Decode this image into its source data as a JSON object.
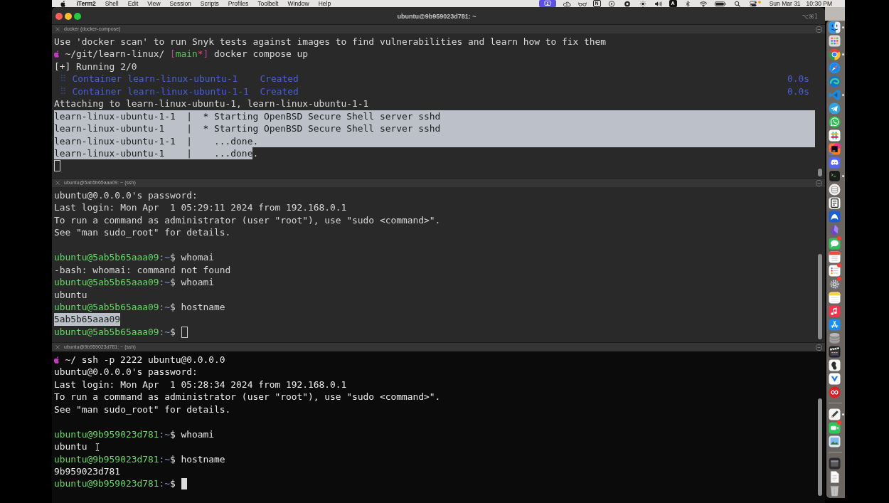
{
  "menu_bar": {
    "menus": [
      {
        "label": "iTerm2",
        "kind": "app"
      },
      {
        "label": "Shell",
        "kind": "menu"
      },
      {
        "label": "Edit",
        "kind": "menu"
      },
      {
        "label": "View",
        "kind": "menu"
      },
      {
        "label": "Session",
        "kind": "menu"
      },
      {
        "label": "Scripts",
        "kind": "menu"
      },
      {
        "label": "Profiles",
        "kind": "menu"
      },
      {
        "label": "Toolbelt",
        "kind": "menu"
      },
      {
        "label": "Window",
        "kind": "menu"
      },
      {
        "label": "Help",
        "kind": "menu"
      }
    ],
    "status_items": [
      {
        "kind": "screen-share",
        "active": true
      },
      {
        "kind": "cloud",
        "active": false
      },
      {
        "kind": "glasses",
        "active": false
      },
      {
        "kind": "boxed-letter",
        "text": "N",
        "active": false
      },
      {
        "kind": "play-circle",
        "active": false
      },
      {
        "kind": "disc",
        "active": false
      },
      {
        "kind": "sun",
        "active": false
      },
      {
        "kind": "speaker",
        "active": false
      },
      {
        "kind": "letter-tile",
        "text": "A",
        "active": false
      },
      {
        "kind": "bluetooth",
        "active": false
      },
      {
        "kind": "wifi",
        "active": false
      },
      {
        "kind": "battery",
        "active": false
      },
      {
        "kind": "search",
        "active": false
      },
      {
        "kind": "control-center",
        "active": false
      },
      {
        "kind": "indicator-dot",
        "active": false
      }
    ],
    "date": "Sun Mar 31",
    "time": "10:30 PM"
  },
  "window": {
    "title": "ubuntu@9b959023d781: ~",
    "shortcut": "⌥⌘1"
  },
  "panes": [
    {
      "title": "docker (docker-compose)",
      "active": false,
      "blocks": [
        {
          "lines": [
            {
              "segments": [
                {
                  "kind": "text",
                  "text": "Use 'docker scan' to run Snyk tests against images to find vulnerabilities and learn how to fix them",
                  "selected": false
                }
              ]
            },
            {
              "segments": [
                {
                  "kind": "logo",
                  "selected": false
                },
                {
                  "kind": "text",
                  "text": " ~/git/learn-linux/ ",
                  "selected": false
                },
                {
                  "kind": "bracket",
                  "text": "[",
                  "selected": false
                },
                {
                  "kind": "branch",
                  "text": "main",
                  "selected": false
                },
                {
                  "kind": "dirty",
                  "text": "*",
                  "selected": false
                },
                {
                  "kind": "bracket",
                  "text": "]",
                  "selected": false
                },
                {
                  "kind": "text",
                  "text": " docker compose up",
                  "selected": false
                }
              ]
            },
            {
              "segments": [
                {
                  "kind": "text",
                  "text": "[+] Running 2/0",
                  "selected": false
                }
              ]
            },
            {
              "segments": [
                {
                  "kind": "dots",
                  "text": " ⠿ ",
                  "selected": false
                },
                {
                  "kind": "info",
                  "text": "Container learn-linux-ubuntu-1    Created",
                  "selected": false
                },
                {
                  "kind": "timing",
                  "text": "0.0s",
                  "selected": false
                }
              ]
            },
            {
              "segments": [
                {
                  "kind": "dots",
                  "text": " ⠿ ",
                  "selected": false
                },
                {
                  "kind": "info",
                  "text": "Container learn-linux-ubuntu-1-1  Created",
                  "selected": false
                },
                {
                  "kind": "timing",
                  "text": "0.0s",
                  "selected": false
                }
              ]
            },
            {
              "segments": [
                {
                  "kind": "text",
                  "text": "Attaching to learn-linux-ubuntu-1, learn-linux-ubuntu-1-1",
                  "selected": false
                }
              ]
            },
            {
              "segments": [
                {
                  "kind": "text",
                  "text": "learn-linux-ubuntu-1-1  |  * Starting OpenBSD Secure Shell server sshd",
                  "selected": true
                },
                {
                  "kind": "line-end",
                  "selected": true
                }
              ]
            },
            {
              "segments": [
                {
                  "kind": "text",
                  "text": "learn-linux-ubuntu-1    |  * Starting OpenBSD Secure Shell server sshd",
                  "selected": true
                },
                {
                  "kind": "line-end",
                  "selected": true
                }
              ]
            },
            {
              "segments": [
                {
                  "kind": "text",
                  "text": "learn-linux-ubuntu-1-1  |    ...done.",
                  "selected": true
                },
                {
                  "kind": "line-end",
                  "selected": true
                }
              ]
            },
            {
              "segments": [
                {
                  "kind": "text",
                  "text": "learn-linux-ubuntu-1    |    ...done",
                  "selected": true
                },
                {
                  "kind": "text",
                  "text": ".",
                  "selected": false
                }
              ]
            },
            {
              "segments": [
                {
                  "kind": "cursor-outline",
                  "selected": false
                }
              ]
            }
          ]
        }
      ]
    },
    {
      "title": "ubuntu@5ab5b65aaa09: ~ (ssh)",
      "active": false,
      "blocks": [
        {
          "lines": [
            {
              "segments": [
                {
                  "kind": "text",
                  "text": "ubuntu@0.0.0.0's password:",
                  "selected": false
                }
              ]
            },
            {
              "segments": [
                {
                  "kind": "text",
                  "text": "Last login: Mon Apr  1 05:29:11 2024 from 192.168.0.1",
                  "selected": false
                }
              ]
            },
            {
              "segments": [
                {
                  "kind": "text",
                  "text": "To run a command as administrator (user \"root\"), use \"sudo <command>\".",
                  "selected": false
                }
              ]
            },
            {
              "segments": [
                {
                  "kind": "text",
                  "text": "See \"man sudo_root\" for details.",
                  "selected": false
                }
              ]
            }
          ]
        },
        {
          "lines": [
            {
              "segments": [
                {
                  "kind": "user",
                  "text": "ubuntu@5ab5b65aaa09",
                  "selected": false
                },
                {
                  "kind": "colon",
                  "text": ":",
                  "selected": false
                },
                {
                  "kind": "tilde",
                  "text": "~",
                  "selected": false
                },
                {
                  "kind": "text",
                  "text": "$ whomai",
                  "selected": false
                }
              ]
            },
            {
              "segments": [
                {
                  "kind": "text",
                  "text": "-bash: whomai: command not found",
                  "selected": false
                }
              ]
            },
            {
              "segments": [
                {
                  "kind": "user",
                  "text": "ubuntu@5ab5b65aaa09",
                  "selected": false
                },
                {
                  "kind": "colon",
                  "text": ":",
                  "selected": false
                },
                {
                  "kind": "tilde",
                  "text": "~",
                  "selected": false
                },
                {
                  "kind": "text",
                  "text": "$ whoami",
                  "selected": false
                }
              ]
            },
            {
              "segments": [
                {
                  "kind": "text",
                  "text": "ubuntu",
                  "selected": false
                }
              ]
            },
            {
              "segments": [
                {
                  "kind": "user",
                  "text": "ubuntu@5ab5b65aaa09",
                  "selected": false
                },
                {
                  "kind": "colon",
                  "text": ":",
                  "selected": false
                },
                {
                  "kind": "tilde",
                  "text": "~",
                  "selected": false
                },
                {
                  "kind": "text",
                  "text": "$ hostname",
                  "selected": false
                }
              ]
            },
            {
              "segments": [
                {
                  "kind": "text",
                  "text": "5ab5b65aaa09",
                  "selected": true
                }
              ]
            },
            {
              "segments": [
                {
                  "kind": "user",
                  "text": "ubuntu@5ab5b65aaa09",
                  "selected": false
                },
                {
                  "kind": "colon",
                  "text": ":",
                  "selected": false
                },
                {
                  "kind": "tilde",
                  "text": "~",
                  "selected": false
                },
                {
                  "kind": "text",
                  "text": "$ ",
                  "selected": false
                },
                {
                  "kind": "cursor-outline",
                  "selected": false
                }
              ]
            }
          ]
        }
      ]
    },
    {
      "title": "ubuntu@9b959023d781: ~ (ssh)",
      "active": true,
      "blocks": [
        {
          "lines": [
            {
              "segments": [
                {
                  "kind": "logo",
                  "selected": false
                },
                {
                  "kind": "text",
                  "text": " ~/ ssh -p 2222 ubuntu@0.0.0.0",
                  "selected": false
                }
              ]
            },
            {
              "segments": [
                {
                  "kind": "text",
                  "text": "ubuntu@0.0.0.0's password:",
                  "selected": false
                }
              ]
            },
            {
              "segments": [
                {
                  "kind": "text",
                  "text": "Last login: Mon Apr  1 05:28:34 2024 from 192.168.0.1",
                  "selected": false
                }
              ]
            },
            {
              "segments": [
                {
                  "kind": "text",
                  "text": "To run a command as administrator (user \"root\"), use \"sudo <command>\".",
                  "selected": false
                }
              ]
            },
            {
              "segments": [
                {
                  "kind": "text",
                  "text": "See \"man sudo_root\" for details.",
                  "selected": false
                }
              ]
            }
          ]
        },
        {
          "lines": [
            {
              "segments": [
                {
                  "kind": "user",
                  "text": "ubuntu@9b959023d781",
                  "selected": false
                },
                {
                  "kind": "colon",
                  "text": ":",
                  "selected": false
                },
                {
                  "kind": "tilde",
                  "text": "~",
                  "selected": false
                },
                {
                  "kind": "text",
                  "text": "$ whoami",
                  "selected": false
                }
              ]
            },
            {
              "segments": [
                {
                  "kind": "text",
                  "text": "ubuntu",
                  "selected": false
                }
              ]
            },
            {
              "segments": [
                {
                  "kind": "user",
                  "text": "ubuntu@9b959023d781",
                  "selected": false
                },
                {
                  "kind": "colon",
                  "text": ":",
                  "selected": false
                },
                {
                  "kind": "tilde",
                  "text": "~",
                  "selected": false
                },
                {
                  "kind": "text",
                  "text": "$ hostname",
                  "selected": false
                }
              ]
            },
            {
              "segments": [
                {
                  "kind": "text",
                  "text": "9b959023d781",
                  "selected": false
                }
              ]
            },
            {
              "segments": [
                {
                  "kind": "user",
                  "text": "ubuntu@9b959023d781",
                  "selected": false
                },
                {
                  "kind": "colon",
                  "text": ":",
                  "selected": false
                },
                {
                  "kind": "tilde",
                  "text": "~",
                  "selected": false
                },
                {
                  "kind": "text",
                  "text": "$ ",
                  "selected": false
                },
                {
                  "kind": "cursor-block",
                  "selected": false
                }
              ]
            }
          ]
        }
      ]
    }
  ],
  "dock": [
    {
      "items": [
        {
          "kind": "face",
          "running": true,
          "badge": false
        },
        {
          "kind": "grid",
          "running": false,
          "badge": false
        },
        {
          "kind": "circle-logo",
          "running": true,
          "badge": false
        },
        {
          "kind": "compass",
          "running": false,
          "badge": false
        },
        {
          "kind": "swirl",
          "running": false,
          "badge": false
        },
        {
          "kind": "chevron-app",
          "running": true,
          "badge": false
        },
        {
          "kind": "paper-plane",
          "running": false,
          "badge": false
        },
        {
          "kind": "phone-bubble",
          "running": false,
          "badge": false
        },
        {
          "kind": "hash",
          "running": false,
          "badge": false
        },
        {
          "kind": "gradient-tile",
          "running": false,
          "badge": false
        },
        {
          "kind": "game-controller",
          "running": false,
          "badge": false
        },
        {
          "kind": "terminal",
          "running": true,
          "badge": false
        },
        {
          "kind": "disk-stack",
          "running": false,
          "badge": false
        },
        {
          "kind": "document-tile",
          "running": false,
          "badge": false
        },
        {
          "kind": "arch",
          "running": false,
          "badge": false
        },
        {
          "kind": "crystal",
          "running": false,
          "badge": false
        },
        {
          "kind": "message-bubble",
          "running": false,
          "badge": true
        },
        {
          "kind": "calendar",
          "running": false,
          "badge": false
        },
        {
          "kind": "checklist",
          "running": false,
          "badge": true
        },
        {
          "kind": "gear",
          "running": false,
          "badge": true
        },
        {
          "kind": "notepad",
          "running": false,
          "badge": false
        },
        {
          "kind": "music-note",
          "running": false,
          "badge": false
        },
        {
          "kind": "triangle-lines",
          "running": false,
          "badge": false
        },
        {
          "kind": "database",
          "running": false,
          "badge": false
        },
        {
          "kind": "clapperboard",
          "running": false,
          "badge": false
        },
        {
          "kind": "figure-tile",
          "running": false,
          "badge": false
        },
        {
          "kind": "chevron-tile",
          "running": false,
          "badge": false
        },
        {
          "kind": "infinity-circle",
          "running": false,
          "badge": false
        }
      ]
    },
    {
      "items": [
        {
          "kind": "pen-paper",
          "running": true,
          "badge": false
        },
        {
          "kind": "video-camera",
          "running": false,
          "badge": true
        },
        {
          "kind": "picture-frame",
          "running": false,
          "badge": false
        }
      ]
    },
    {
      "items": [
        {
          "kind": "window-tile",
          "running": false,
          "badge": false
        },
        {
          "kind": "document",
          "running": false,
          "badge": false
        },
        {
          "kind": "trash",
          "running": false,
          "badge": false
        }
      ]
    }
  ]
}
